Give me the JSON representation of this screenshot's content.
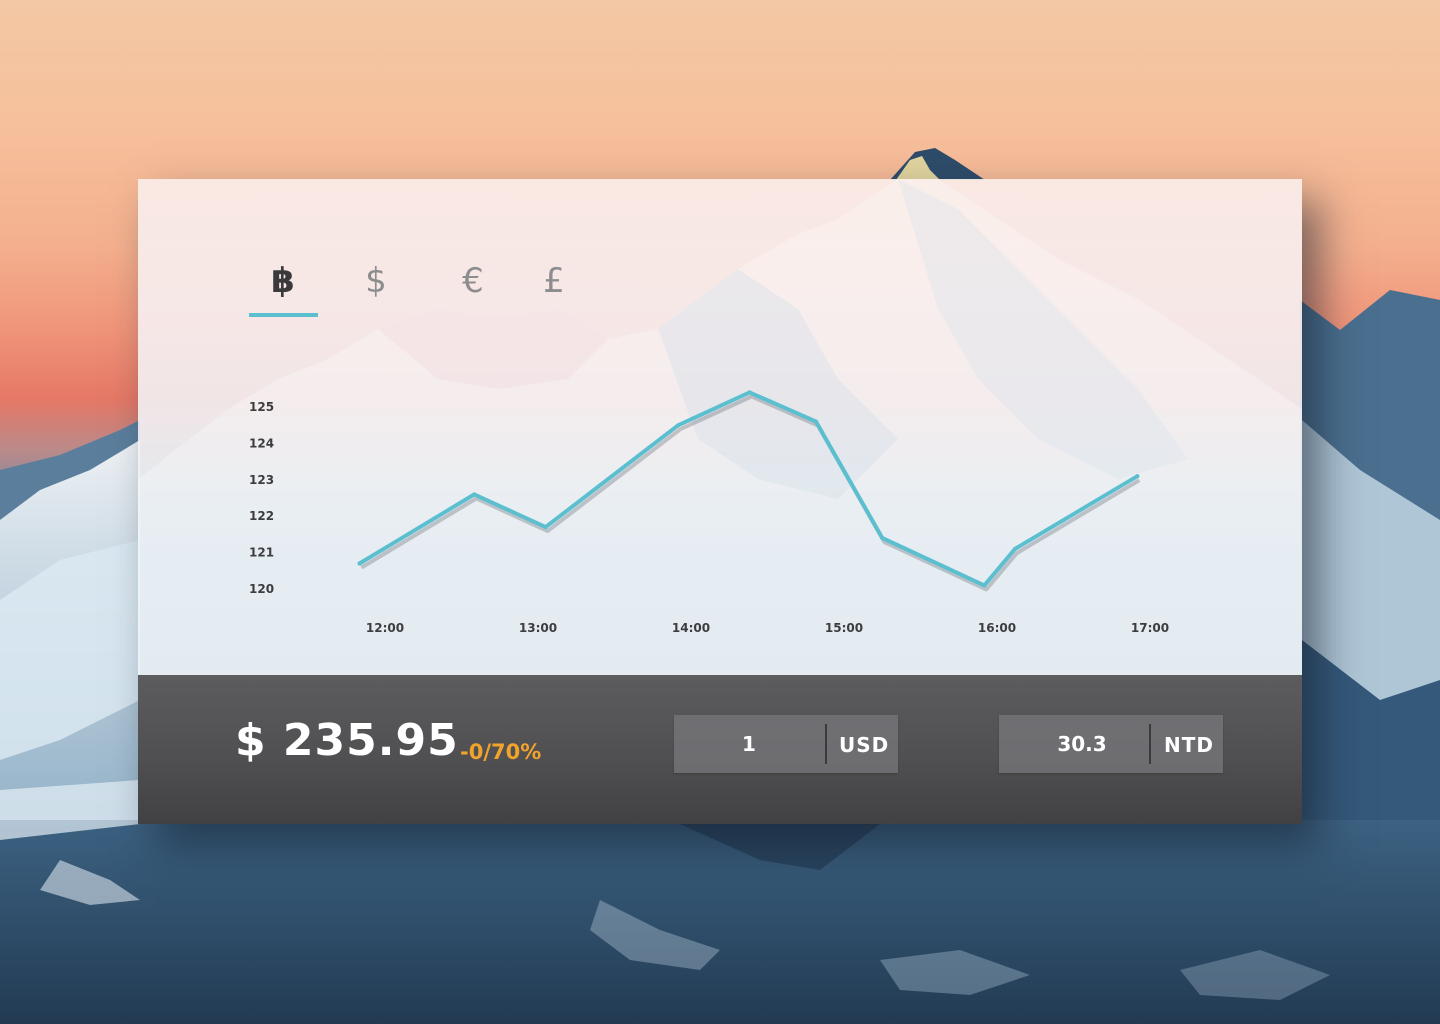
{
  "currency_tabs": [
    {
      "symbol": "฿",
      "icon": "bitcoin-icon",
      "active": true
    },
    {
      "symbol": "$",
      "icon": "dollar-icon",
      "active": false
    },
    {
      "symbol": "€",
      "icon": "euro-icon",
      "active": false
    },
    {
      "symbol": "£",
      "icon": "pound-icon",
      "active": false
    }
  ],
  "summary": {
    "price": "$ 235.95",
    "change": "-0/70%"
  },
  "converter": {
    "from_value": "1",
    "from_unit": "USD",
    "to_value": "30.3",
    "to_unit": "NTD"
  },
  "colors": {
    "accent": "#5cbfcf",
    "change": "#f1a32c",
    "footer": "#505052"
  },
  "chart_data": {
    "type": "line",
    "x_ticks": [
      "12:00",
      "13:00",
      "14:00",
      "15:00",
      "16:00",
      "17:00"
    ],
    "y_ticks": [
      120,
      121,
      122,
      123,
      124,
      125
    ],
    "ylim": [
      120,
      125
    ],
    "grid": false,
    "series": [
      {
        "x": [
          "11:50",
          "12:35",
          "13:03",
          "13:55",
          "14:23",
          "14:49",
          "15:15",
          "15:55",
          "16:07",
          "16:55"
        ],
        "values": [
          120.7,
          122.6,
          121.7,
          124.5,
          125.4,
          124.6,
          121.4,
          120.1,
          121.1,
          123.1
        ]
      }
    ]
  }
}
